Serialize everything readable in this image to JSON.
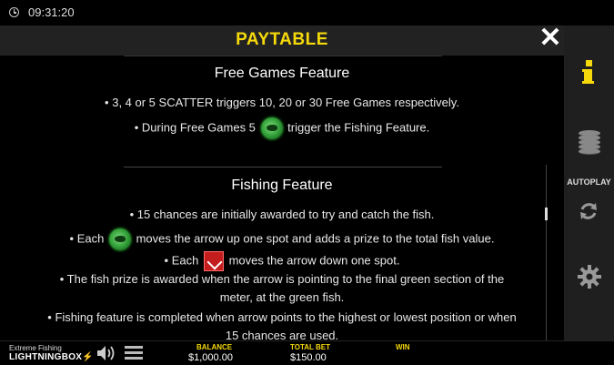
{
  "status": {
    "time": "09:31:20"
  },
  "header": {
    "title": "PAYTABLE",
    "close_symbol": "✕"
  },
  "free_games": {
    "title": "Free Games Feature",
    "line1": "• 3, 4 or 5 SCATTER triggers 10, 20 or 30 Free Games respectively.",
    "line2_a": "• During Free Games 5",
    "line2_b": "trigger the Fishing Feature."
  },
  "fishing": {
    "title": "Fishing Feature",
    "line1": "• 15 chances are initially awarded to try and catch the fish.",
    "line2_a": "• Each",
    "line2_b": "moves the arrow up one spot and adds a prize to the total fish value.",
    "line3_a": "• Each",
    "line3_b": "moves the arrow down one spot.",
    "line4": "• The fish prize is awarded when the arrow is pointing to the final green section of the",
    "line5": "meter, at the green fish.",
    "line6": "• Fishing feature is completed when arrow points to the highest or lowest position or when",
    "line7": "15 chances are used."
  },
  "side": {
    "autoplay_label": "AUTOPLAY"
  },
  "bottom": {
    "brand_line1": "Extreme Fishing",
    "brand_line2_a": "LIGHTNING",
    "brand_line2_b": "BOX",
    "balance_label": "BALANCE",
    "balance_value": "$1,000.00",
    "total_bet_label": "TOTAL BET",
    "total_bet_value": "$150.00",
    "win_label": "WIN"
  },
  "colors": {
    "accent": "#f5d90a",
    "panel": "#1f1f1f",
    "header": "#222222"
  },
  "icons": [
    "clock-icon",
    "close-icon",
    "info-icon",
    "coins-icon",
    "refresh-icon",
    "gear-icon",
    "speaker-icon",
    "menu-icon"
  ]
}
